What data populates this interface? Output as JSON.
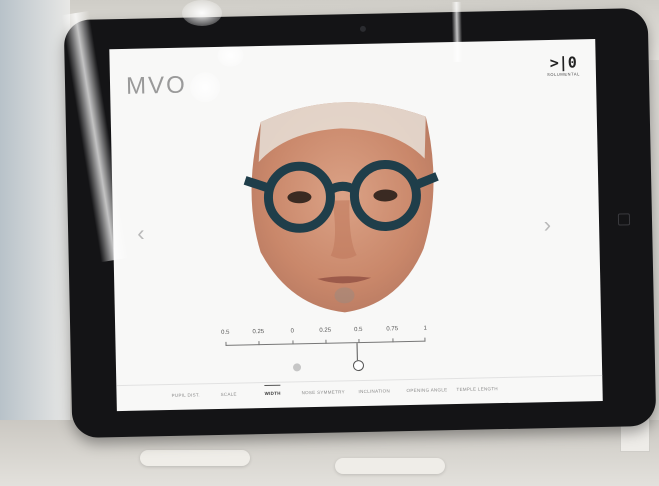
{
  "app": {
    "title": "MVO"
  },
  "logo": {
    "mark": ">|0",
    "subtitle": "SOLUMENTAL"
  },
  "nav": {
    "prev": "‹",
    "next": "›"
  },
  "slider": {
    "labels": [
      "0.5",
      "0.25",
      "0",
      "0.25",
      "0.5",
      "0.75",
      "1"
    ],
    "value": 0.5
  },
  "tabs": [
    "PUPIL DIST.",
    "SCALE",
    "WIDTH",
    "NOSE SYMMETRY",
    "INCLINATION",
    "OPENING ANGLE",
    "TEMPLE LENGTH"
  ],
  "active_tab": "WIDTH",
  "colors": {
    "frame": "#1f3e4a",
    "screen": "#f8f8f7",
    "bezel": "#141416"
  }
}
